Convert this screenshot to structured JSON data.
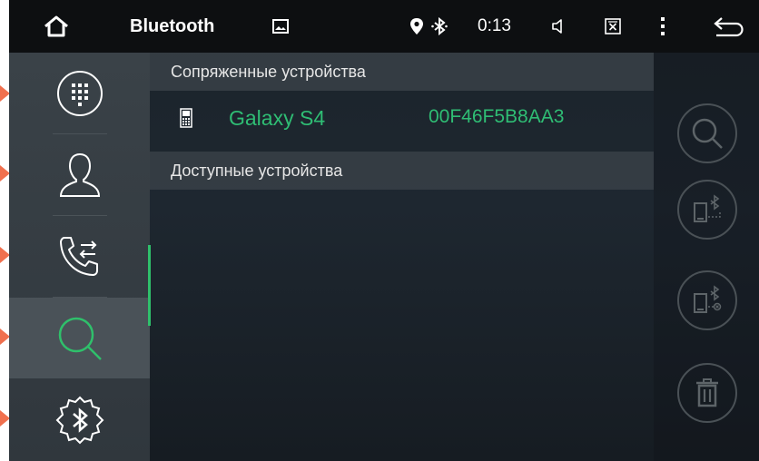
{
  "statusbar": {
    "app_title": "Bluetooth",
    "time": "0:13",
    "icons": [
      "home-icon",
      "image-icon",
      "location-icon",
      "bluetooth-icon",
      "volume-icon",
      "close-box-icon",
      "more-vert-icon",
      "back-icon"
    ]
  },
  "sidebar": {
    "items": [
      {
        "name": "dialpad",
        "icon": "dialpad-icon",
        "active": false
      },
      {
        "name": "contacts",
        "icon": "contact-icon",
        "active": false
      },
      {
        "name": "call-log",
        "icon": "call-transfer-icon",
        "active": false
      },
      {
        "name": "search-devices",
        "icon": "search-icon",
        "active": true
      },
      {
        "name": "bt-settings",
        "icon": "bluetooth-settings-icon",
        "active": false
      }
    ]
  },
  "content": {
    "paired_header": "Сопряженные устройства",
    "paired_devices": [
      {
        "name": "Galaxy S4",
        "mac": "00F46F5B8AA3",
        "icon": "phone-icon"
      }
    ],
    "available_header": "Доступные устройства",
    "available_devices": []
  },
  "actions": {
    "buttons": [
      "search-icon",
      "connect-device-icon",
      "disconnect-device-icon",
      "delete-icon"
    ]
  },
  "colors": {
    "accent": "#2fbd74",
    "statusbar_bg": "#0d0f11",
    "sidebar_bg": "#363d43",
    "marker": "#f0704e"
  }
}
